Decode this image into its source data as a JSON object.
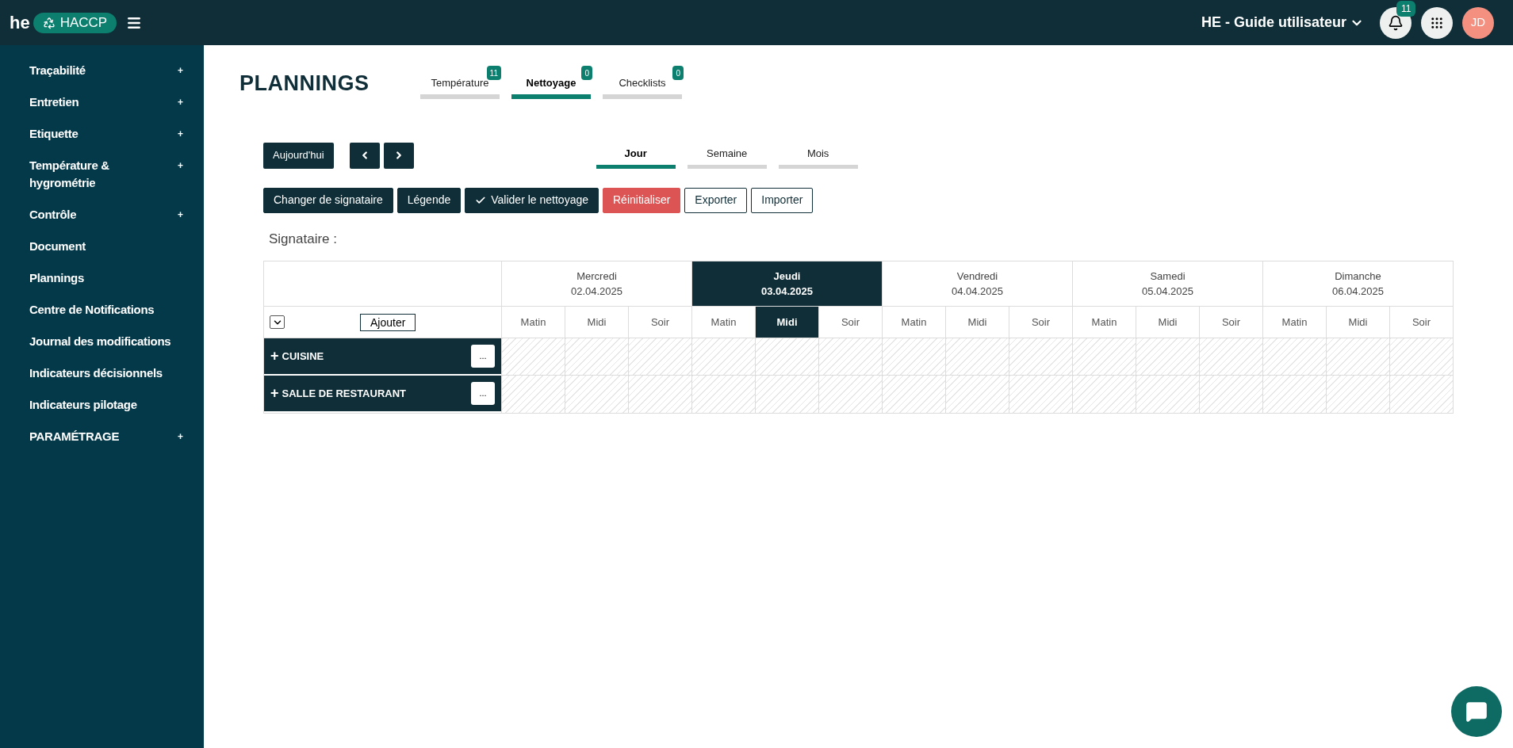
{
  "topbar": {
    "logo": "he",
    "app_badge": "HACCP",
    "account": "HE - Guide utilisateur",
    "notifications": "11",
    "avatar": "JD"
  },
  "sidebar": {
    "items": [
      {
        "label": "Traçabilité",
        "toggle": "+"
      },
      {
        "label": "Entretien",
        "toggle": "+"
      },
      {
        "label": "Etiquette",
        "toggle": "+"
      },
      {
        "label": "Température & hygrométrie",
        "toggle": "+"
      },
      {
        "label": "Contrôle",
        "toggle": "+"
      },
      {
        "label": "Document"
      },
      {
        "label": "Plannings"
      },
      {
        "label": "Centre de Notifications"
      },
      {
        "label": "Journal des modifications"
      },
      {
        "label": "Indicateurs décisionnels"
      },
      {
        "label": "Indicateurs pilotage"
      },
      {
        "label": "PARAMÉTRAGE",
        "toggle": "+"
      }
    ]
  },
  "page": {
    "title": "PLANNINGS",
    "tabs": [
      {
        "label": "Température",
        "count": "11",
        "selected": false
      },
      {
        "label": "Nettoyage",
        "count": "0",
        "selected": true
      },
      {
        "label": "Checklists",
        "count": "0",
        "selected": false
      }
    ],
    "today_button": "Aujourd'hui",
    "view_tabs": [
      {
        "label": "Jour",
        "selected": true
      },
      {
        "label": "Semaine",
        "selected": false
      },
      {
        "label": "Mois",
        "selected": false
      }
    ],
    "actions": [
      {
        "label": "Changer de signataire",
        "kind": "dark"
      },
      {
        "label": "Légende",
        "kind": "dark"
      },
      {
        "label": "Valider le nettoyage",
        "kind": "check"
      },
      {
        "label": "Réinitialiser",
        "kind": "danger"
      },
      {
        "label": "Exporter",
        "kind": "outline"
      },
      {
        "label": "Importer",
        "kind": "outline"
      }
    ],
    "signatory_label": "Signataire :"
  },
  "planning": {
    "add_button": "Ajouter",
    "days": [
      {
        "name": "Mercredi",
        "date": "02.04.2025",
        "selected": false,
        "slots": [
          {
            "label": "Matin",
            "selected": false
          },
          {
            "label": "Midi",
            "selected": false
          },
          {
            "label": "Soir",
            "selected": false
          }
        ]
      },
      {
        "name": "Jeudi",
        "date": "03.04.2025",
        "selected": true,
        "slots": [
          {
            "label": "Matin",
            "selected": false
          },
          {
            "label": "Midi",
            "selected": true
          },
          {
            "label": "Soir",
            "selected": false
          }
        ]
      },
      {
        "name": "Vendredi",
        "date": "04.04.2025",
        "selected": false,
        "slots": [
          {
            "label": "Matin",
            "selected": false
          },
          {
            "label": "Midi",
            "selected": false
          },
          {
            "label": "Soir",
            "selected": false
          }
        ]
      },
      {
        "name": "Samedi",
        "date": "05.04.2025",
        "selected": false,
        "slots": [
          {
            "label": "Matin",
            "selected": false
          },
          {
            "label": "Midi",
            "selected": false
          },
          {
            "label": "Soir",
            "selected": false
          }
        ]
      },
      {
        "name": "Dimanche",
        "date": "06.04.2025",
        "selected": false,
        "slots": [
          {
            "label": "Matin",
            "selected": false
          },
          {
            "label": "Midi",
            "selected": false
          },
          {
            "label": "Soir",
            "selected": false
          }
        ]
      }
    ],
    "rows": [
      {
        "expander": "+",
        "label": "CUISINE",
        "menu": "..."
      },
      {
        "expander": "+",
        "label": "SALLE DE RESTAURANT",
        "menu": "..."
      }
    ]
  }
}
